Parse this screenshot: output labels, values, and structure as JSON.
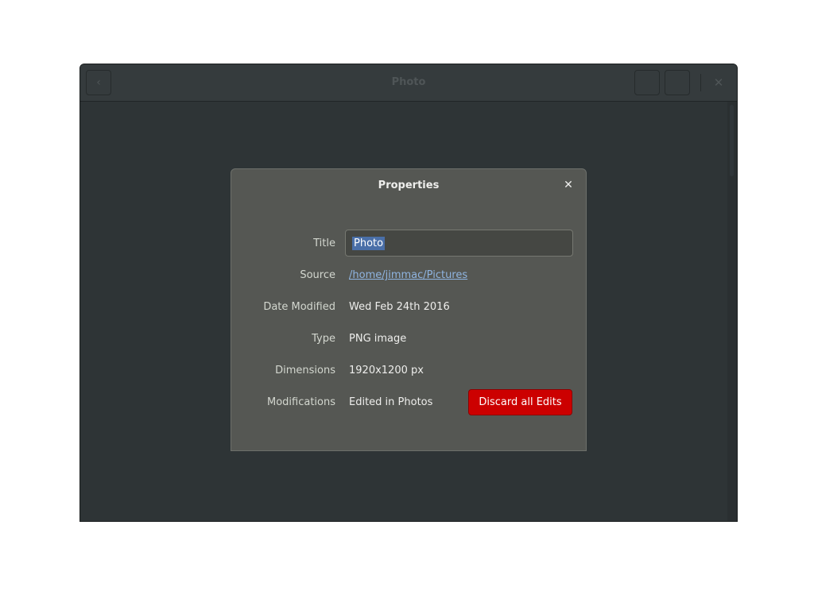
{
  "window": {
    "title": "Photo",
    "back_icon": "chevron-left-icon",
    "close_icon": "close-icon",
    "close_glyph": "✕",
    "back_glyph": "‹"
  },
  "dialog": {
    "title": "Properties",
    "close_glyph": "✕",
    "rows": {
      "title": {
        "label": "Title",
        "value": "Photo"
      },
      "source": {
        "label": "Source",
        "value": "/home/jimmac/Pictures"
      },
      "date": {
        "label": "Date Modified",
        "value": "Wed Feb 24th 2016"
      },
      "type": {
        "label": "Type",
        "value": "PNG image"
      },
      "dimensions": {
        "label": "Dimensions",
        "value": "1920x1200 px"
      },
      "modifications": {
        "label": "Modifications",
        "value": "Edited in Photos"
      }
    },
    "discard_label": "Discard all Edits"
  },
  "colors": {
    "window_bg": "#2e3436",
    "dialog_bg": "#555753",
    "destructive": "#cc0000",
    "selection": "#4a6fa8",
    "link": "#8fb4e0"
  }
}
